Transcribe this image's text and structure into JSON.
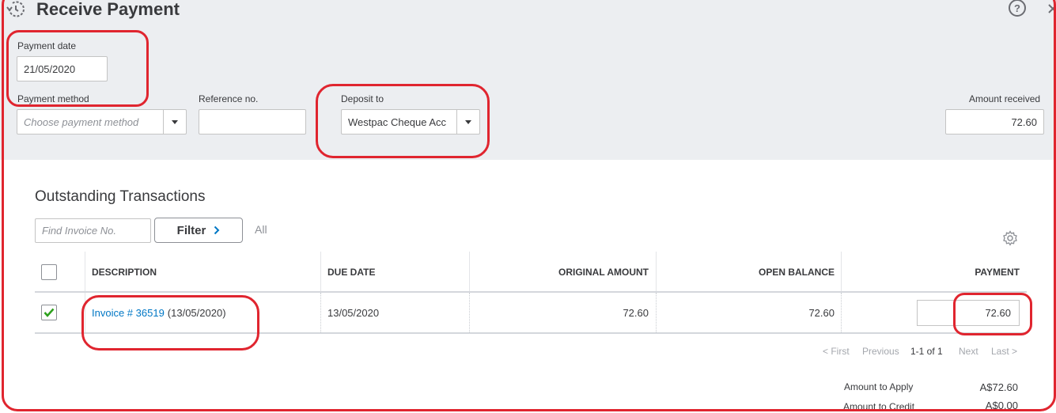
{
  "header": {
    "title": "Receive Payment"
  },
  "form": {
    "payment_date": {
      "label": "Payment date",
      "value": "21/05/2020"
    },
    "payment_method": {
      "label": "Payment method",
      "placeholder": "Choose payment method"
    },
    "reference_no": {
      "label": "Reference no.",
      "value": ""
    },
    "deposit_to": {
      "label": "Deposit to",
      "value": "Westpac Cheque Acc"
    },
    "amount_received": {
      "label": "Amount received",
      "value": "72.60"
    }
  },
  "outstanding": {
    "title": "Outstanding Transactions",
    "find_placeholder": "Find Invoice No.",
    "filter_label": "Filter",
    "all_label": "All",
    "columns": [
      "DESCRIPTION",
      "DUE DATE",
      "ORIGINAL AMOUNT",
      "OPEN BALANCE",
      "PAYMENT"
    ],
    "rows": [
      {
        "checked": true,
        "invoice_link": "Invoice # 36519",
        "invoice_date": "(13/05/2020)",
        "due_date": "13/05/2020",
        "original_amount": "72.60",
        "open_balance": "72.60",
        "payment": "72.60"
      }
    ]
  },
  "pagination": {
    "first": "< First",
    "previous": "Previous",
    "range": "1-1 of 1",
    "next": "Next",
    "last": "Last >"
  },
  "summary": {
    "amount_to_apply_label": "Amount to Apply",
    "amount_to_apply_value": "A$72.60",
    "amount_to_credit_label": "Amount to Credit",
    "amount_to_credit_value": "A$0.00"
  },
  "colors": {
    "header_bg": "#eceef1",
    "link": "#0077c5",
    "check_green": "#2ca01c",
    "annotation_red": "#e0252f"
  }
}
